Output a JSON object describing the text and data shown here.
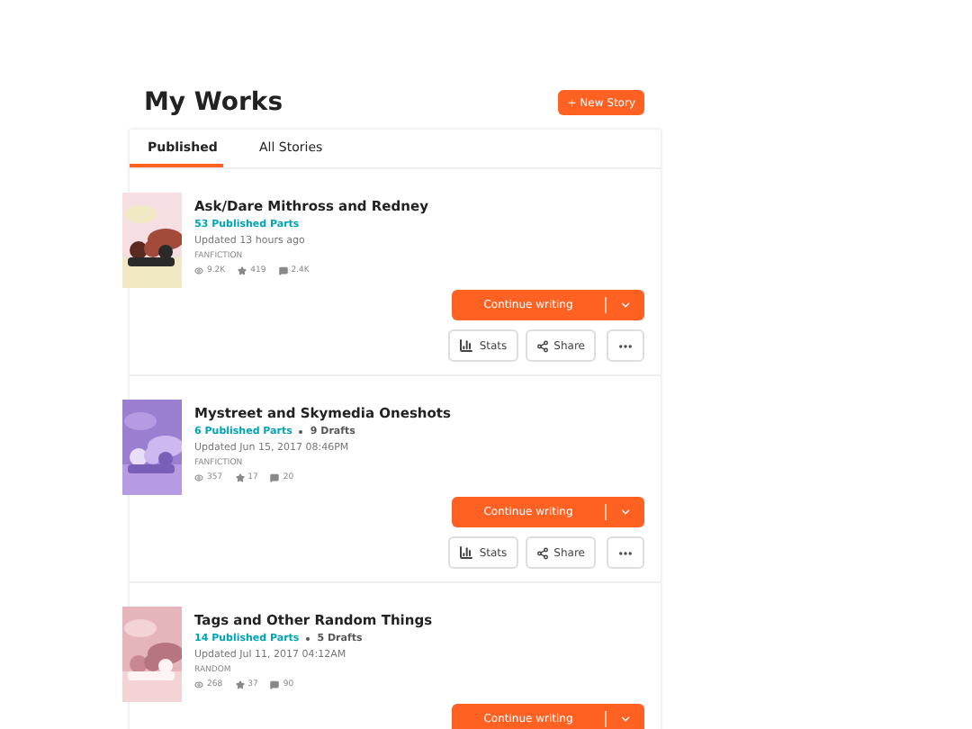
{
  "page": {
    "title": "My Works",
    "new_story_button": "+ New Story"
  },
  "tabs": [
    {
      "label": "Published",
      "selected": true
    },
    {
      "label": "All Stories",
      "selected": false
    }
  ],
  "stories": [
    {
      "cover": {
        "kind": "picture"
      },
      "title": "Ask/Dare Mithross and Redney",
      "published_parts": "53 Published Parts",
      "updated": "Updated 13 hours ago",
      "category": "FANFICTION",
      "reads": "9.2K",
      "votes": "419",
      "comments": "2.4K",
      "continue_label": "Continue writing",
      "actions": [
        "Stats",
        "Share"
      ]
    },
    {
      "cover": {
        "kind": "picture"
      },
      "title": "Mystreet and Skymedia Oneshots",
      "published_parts": "6 Published Parts",
      "drafts": "9 Drafts",
      "updated": "Updated Jun 15, 2017 08:46PM",
      "category": "FANFICTION",
      "reads": "357",
      "votes": "17",
      "comments": "20",
      "continue_label": "Continue writing",
      "actions": [
        "Stats",
        "Share"
      ]
    },
    {
      "cover": {
        "kind": "picture"
      },
      "title": "Tags and Other Random Things",
      "published_parts": "14 Published Parts",
      "drafts": "5 Drafts",
      "updated": "Updated Jul 11, 2017 04:12AM",
      "category": "RANDOM",
      "reads": "268",
      "votes": "37",
      "comments": "90",
      "continue_label": "Continue writing"
    }
  ]
}
